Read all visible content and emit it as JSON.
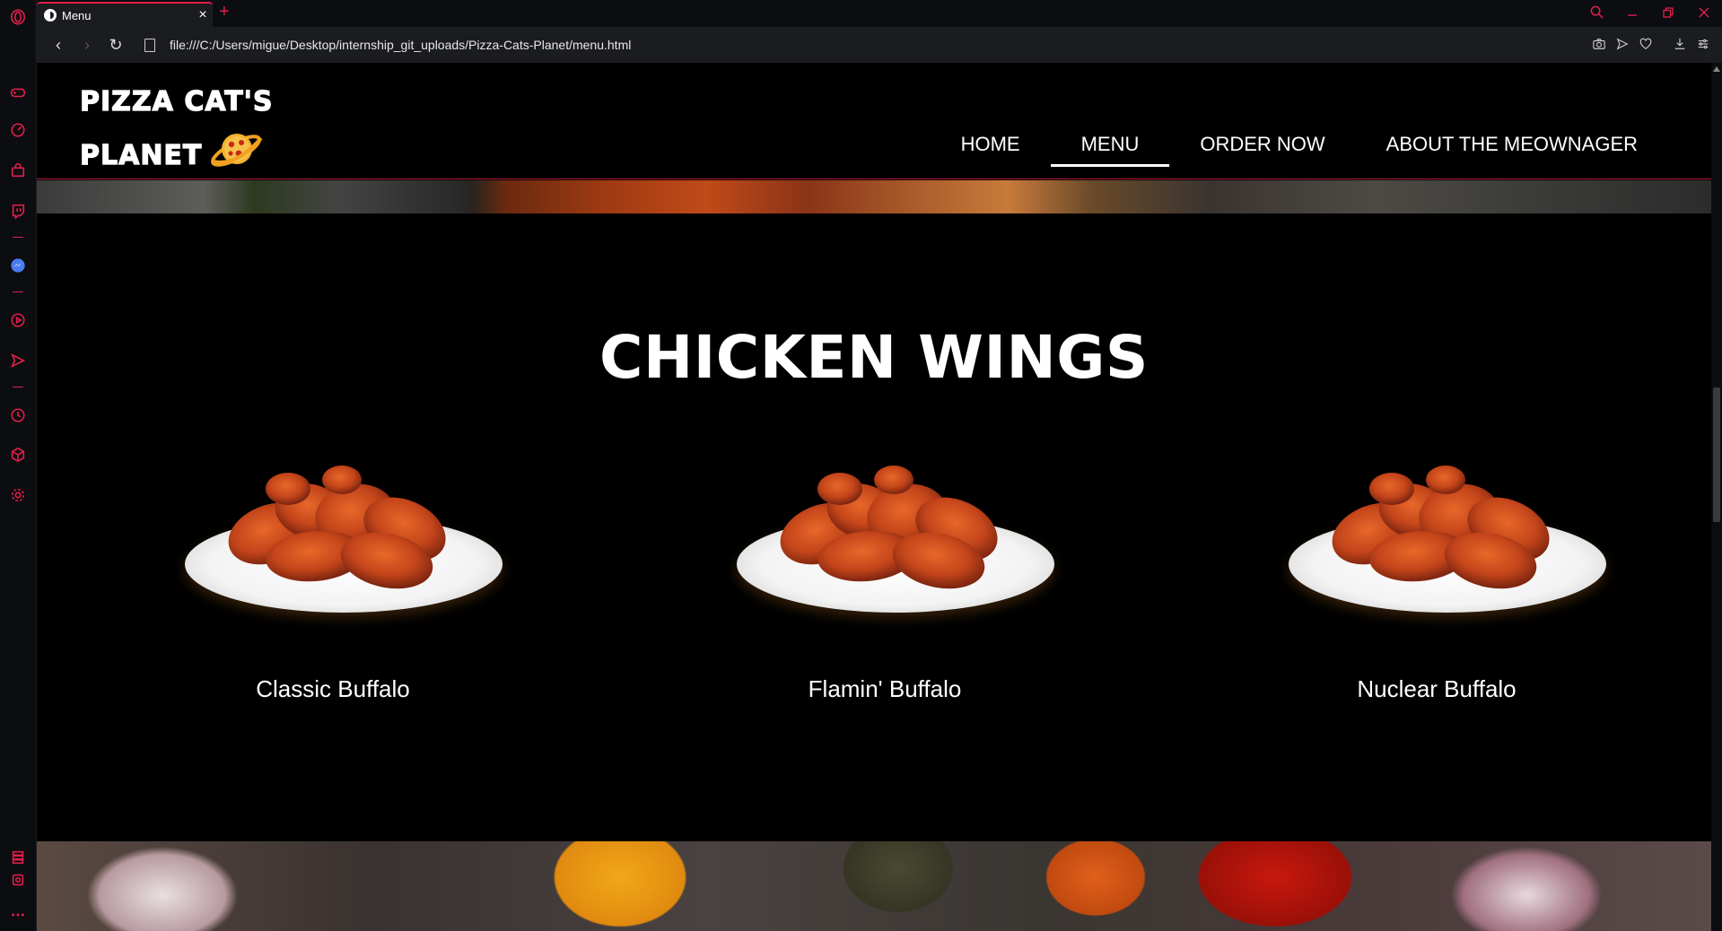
{
  "browser": {
    "tab_title": "Menu",
    "tab_close": "×",
    "new_tab": "+",
    "url": "file:///C:/Users/migue/Desktop/internship_git_uploads/Pizza-Cats-Planet/menu.html",
    "back": "‹",
    "forward": "›",
    "reload": "↻"
  },
  "site": {
    "logo_line1": "PIZZA CAT'S",
    "logo_line2": "PLANET",
    "nav": [
      {
        "label": "HOME",
        "active": false
      },
      {
        "label": "MENU",
        "active": true
      },
      {
        "label": "ORDER NOW",
        "active": false
      },
      {
        "label": "ABOUT THE MEOWNAGER",
        "active": false
      }
    ]
  },
  "section": {
    "title": "CHICKEN WINGS",
    "items": [
      {
        "name": "Classic Buffalo"
      },
      {
        "name": "Flamin' Buffalo"
      },
      {
        "name": "Nuclear Buffalo"
      }
    ]
  },
  "colors": {
    "accent": "#e01f4b",
    "background": "#000000",
    "chrome": "#1b1c20"
  },
  "icons": {
    "sidebar": [
      "opera-logo-icon",
      "gamepad-icon",
      "speed-dial-icon",
      "bag-icon",
      "twitch-icon",
      "messenger-icon",
      "player-icon",
      "send-icon",
      "history-icon",
      "cube-icon",
      "settings-icon",
      "tabs-icon",
      "extensions-icon",
      "more-icon"
    ],
    "address_bar": [
      "snapshot-icon",
      "send-icon",
      "heart-icon",
      "download-icon",
      "easy-setup-icon"
    ]
  }
}
